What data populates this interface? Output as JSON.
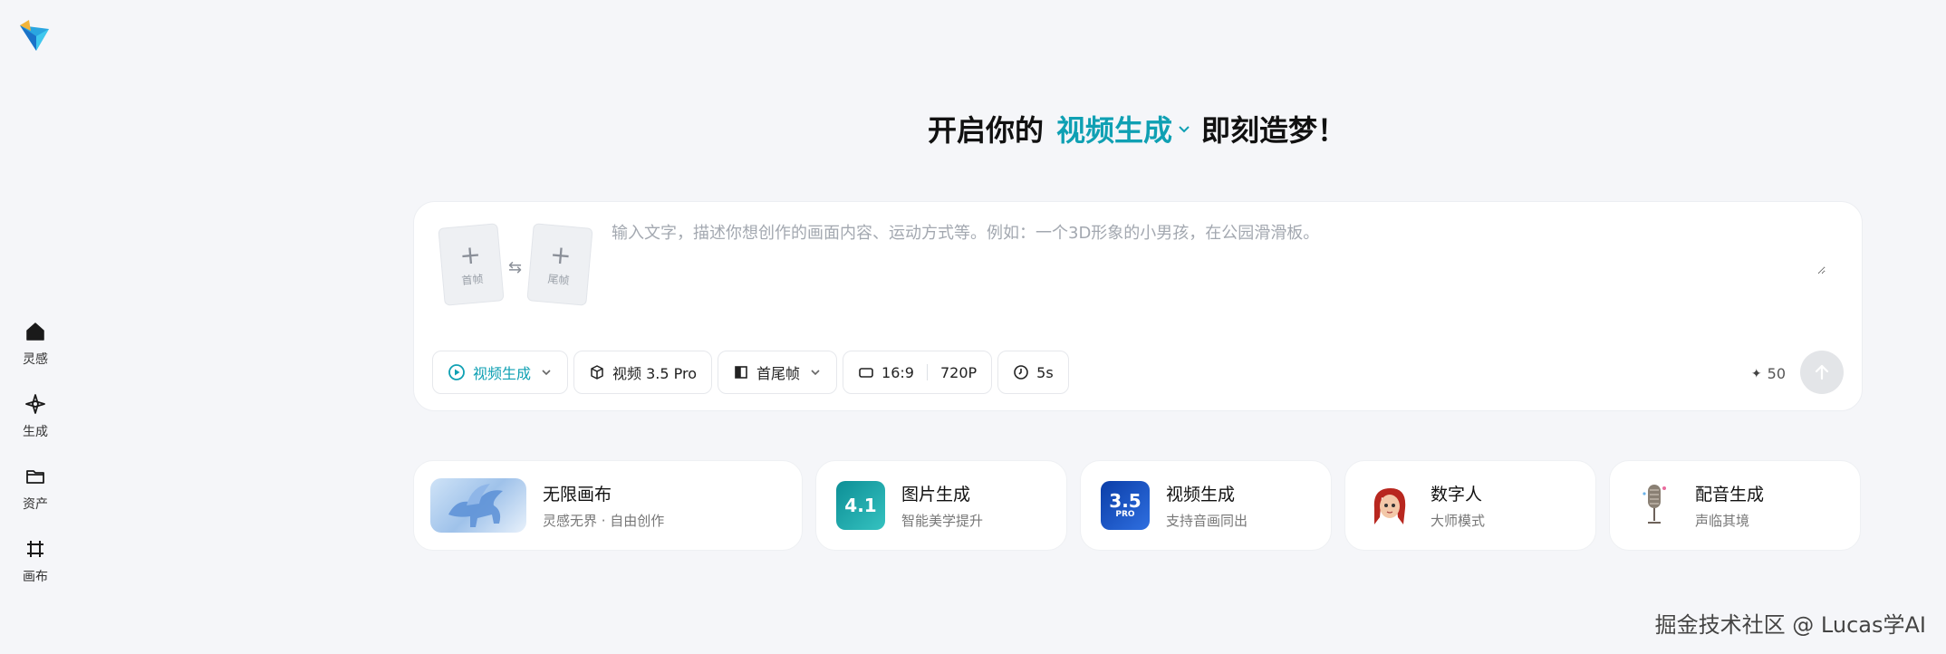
{
  "headline": {
    "prefix": "开启你的",
    "mode": "视频生成",
    "suffix": "即刻造梦！"
  },
  "sidebar": {
    "items": [
      {
        "label": "灵感",
        "icon": "home-icon"
      },
      {
        "label": "生成",
        "icon": "sparkle-icon"
      },
      {
        "label": "资产",
        "icon": "folder-icon"
      },
      {
        "label": "画布",
        "icon": "canvas-icon"
      }
    ]
  },
  "prompt": {
    "placeholder": "输入文字，描述你想创作的画面内容、运动方式等。例如：一个3D形象的小男孩，在公园滑滑板。",
    "first_frame": "首帧",
    "last_frame": "尾帧"
  },
  "toolbar": {
    "mode": "视频生成",
    "model": "视频 3.5 Pro",
    "frames": "首尾帧",
    "ratio": "16:9",
    "resolution": "720P",
    "duration": "5s",
    "credits": "50"
  },
  "cards": [
    {
      "title": "无限画布",
      "subtitle": "灵感无界 · 自由创作"
    },
    {
      "title": "图片生成",
      "subtitle": "智能美学提升",
      "badge": "4.1"
    },
    {
      "title": "视频生成",
      "subtitle": "支持音画同出",
      "badge": "3.5",
      "badge_sub": "PRO"
    },
    {
      "title": "数字人",
      "subtitle": "大师模式"
    },
    {
      "title": "配音生成",
      "subtitle": "声临其境"
    }
  ],
  "watermark": "掘金技术社区 @ Lucas学AI",
  "colors": {
    "accent": "#0fa0b3",
    "background": "#f5f6f9"
  }
}
